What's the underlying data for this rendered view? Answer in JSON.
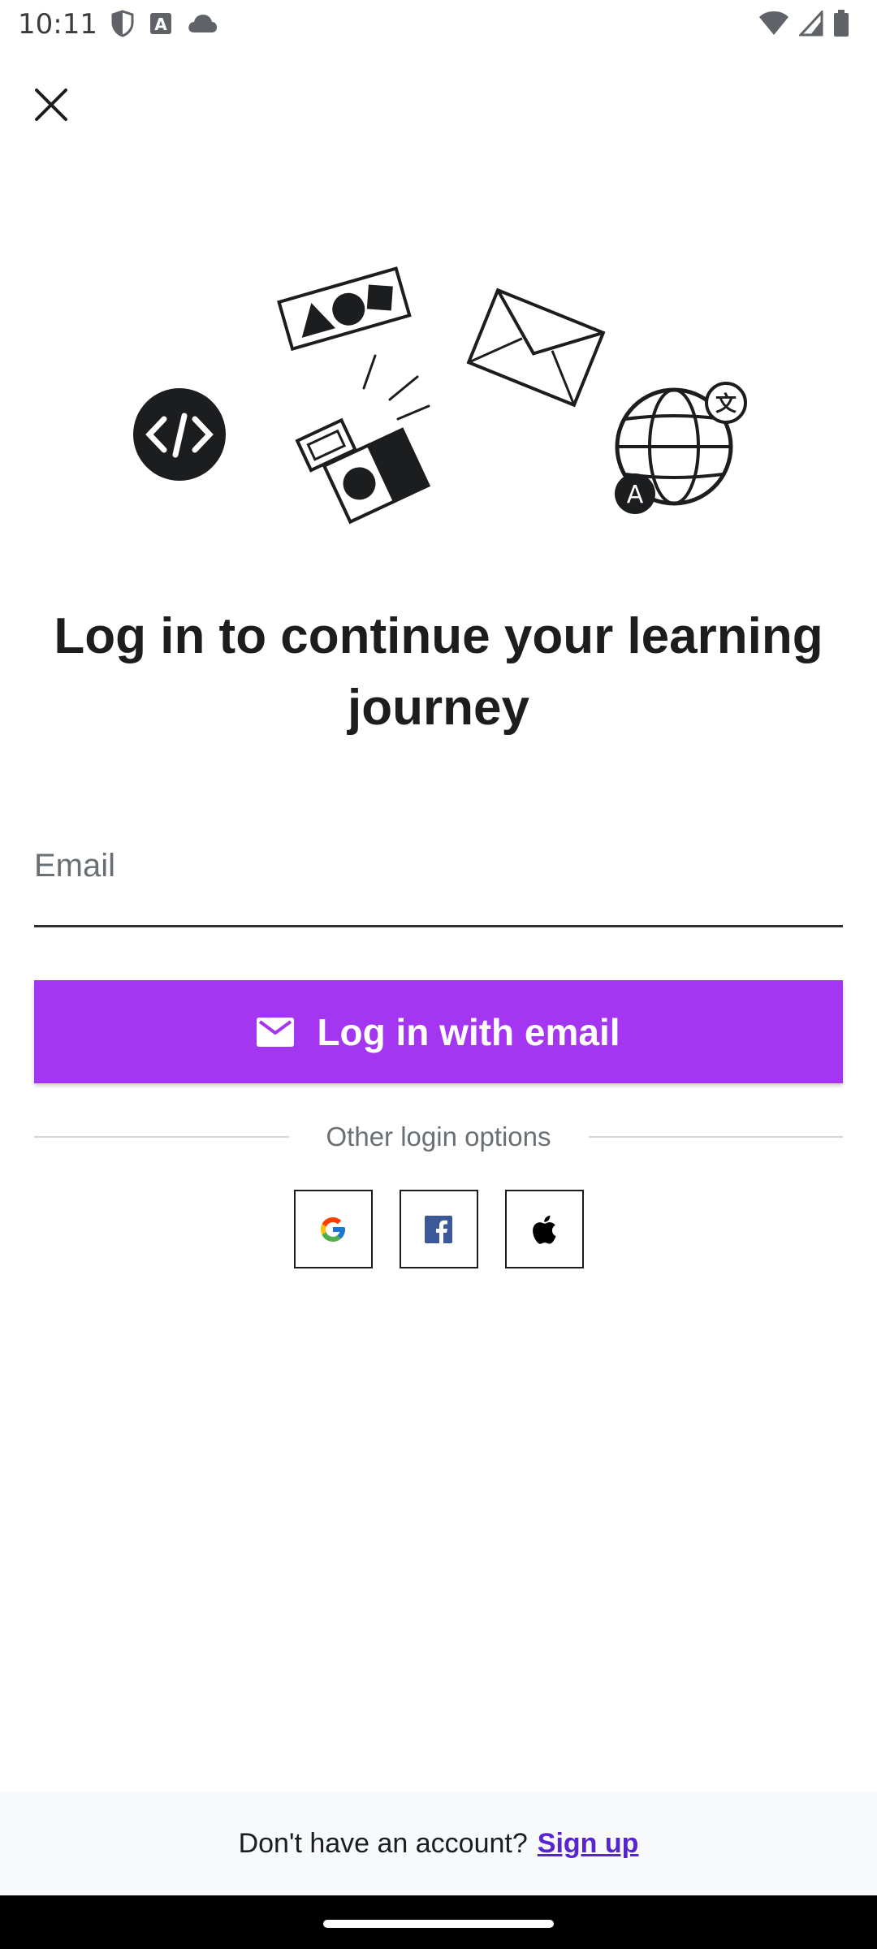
{
  "status_bar": {
    "time": "10:11"
  },
  "header": {
    "close_icon": "close-icon"
  },
  "main": {
    "heading": "Log in to continue your learning journey",
    "email": {
      "placeholder": "Email",
      "value": ""
    },
    "login_button_label": "Log in with email",
    "divider_text": "Other login options",
    "social": [
      {
        "name": "google",
        "icon": "google-icon"
      },
      {
        "name": "facebook",
        "icon": "facebook-icon"
      },
      {
        "name": "apple",
        "icon": "apple-icon"
      }
    ]
  },
  "footer": {
    "prompt": "Don't have an account?",
    "signup_link": "Sign up"
  },
  "colors": {
    "accent": "#a435f0",
    "link": "#5624d0",
    "text": "#1c1d1f"
  }
}
